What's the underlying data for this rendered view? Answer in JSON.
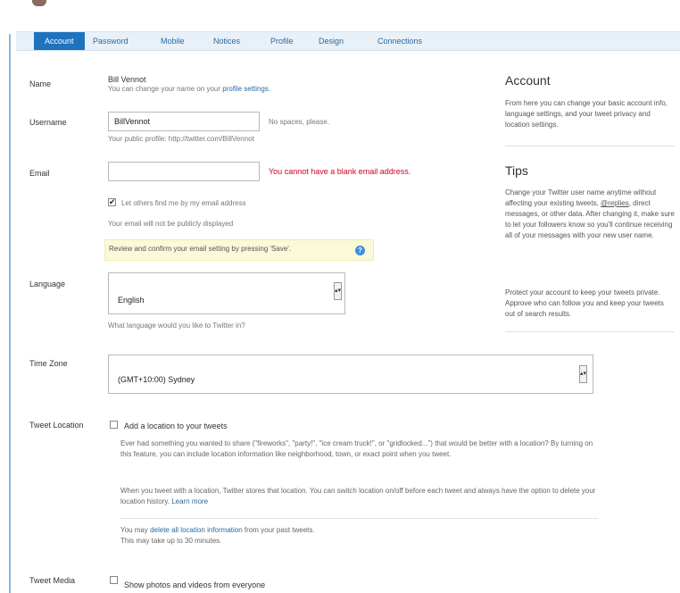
{
  "tabs": [
    "Account",
    "Password",
    "Mobile",
    "Notices",
    "Profile",
    "Design",
    "Connections"
  ],
  "name": {
    "label": "Name",
    "value": "Bill Vennot",
    "help_prefix": "You can change your name on your ",
    "help_link": "profile settings",
    "help_suffix": "."
  },
  "username": {
    "label": "Username",
    "value": "BillVennot",
    "hint": "No spaces, please.",
    "help": "Your public profile: http://twitter.com/BillVennot"
  },
  "email": {
    "label": "Email",
    "value": "",
    "error": "You cannot have a blank email address.",
    "checkbox_label": "Let others find me by my email address",
    "checked": true,
    "note": "Your email will not be publicly displayed",
    "notice": "Review and confirm your email setting by pressing 'Save'."
  },
  "language": {
    "label": "Language",
    "value": "English",
    "help": "What language would you like to Twitter in?"
  },
  "timezone": {
    "label": "Time Zone",
    "value": "(GMT+10:00) Sydney"
  },
  "tweet_location": {
    "label": "Tweet Location",
    "checkbox_label": "Add a location to your tweets",
    "checked": false,
    "para1": "Ever had something you wanted to share (\"fireworks\", \"party!\", \"ice cream truck!\", or \"gridlocked...\") that would be better with a location? By turning on this feature, you can include location information like neighborhood, town, or exact point when you tweet.",
    "para2_main": "When you tweet with a location, Twitter stores that location. You can switch location on/off before each tweet and always have the option to delete your location history. ",
    "para2_link": "Learn more",
    "para3_prefix": "You may ",
    "para3_link": "delete all location information",
    "para3_suffix": " from your past tweets.",
    "para3_line2": "This may take up to 30 minutes."
  },
  "tweet_media": {
    "label": "Tweet Media",
    "checkbox_label": "Show photos and videos from everyone",
    "checked": false
  },
  "sidebar": {
    "account_title": "Account",
    "account_text": "From here you can change your basic account info, language settings, and your tweet privacy and location settings.",
    "tips_title": "Tips",
    "tips_p1_a": "Change your Twitter user name anytime without affecting your existing tweets, ",
    "tips_p1_b": "@replies",
    "tips_p1_c": ", direct messages, or other data. After changing it, make sure to let your followers know so you'll continue receiving all of your messages with your new user name.",
    "tips_p2": "Protect your account to keep your tweets private. Approve who can follow you and keep your tweets out of search results."
  }
}
